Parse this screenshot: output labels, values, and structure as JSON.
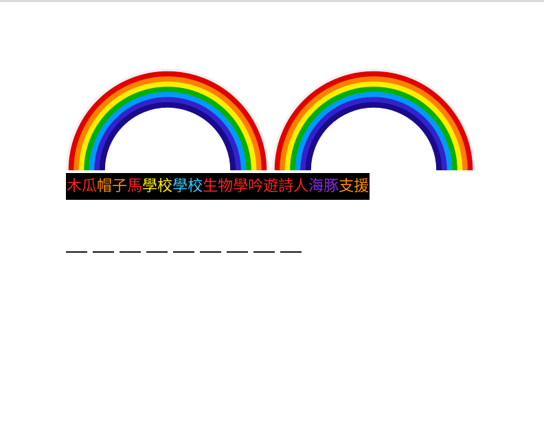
{
  "rainbow": {
    "bands": [
      "#e00000",
      "#ff7f00",
      "#ffee00",
      "#00b000",
      "#0099ff",
      "#3322cc",
      "#1a0a8c"
    ]
  },
  "banner": {
    "background": "#000000",
    "words": [
      {
        "text": "木瓜",
        "color": "#ff2020"
      },
      {
        "text": "帽子",
        "color": "#ff8c00"
      },
      {
        "text": "馬",
        "color": "#ff2020"
      },
      {
        "text": "學校",
        "color": "#ffee00"
      },
      {
        "text": "學校",
        "color": "#33ccff"
      },
      {
        "text": "生物學",
        "color": "#ff2020"
      },
      {
        "text": "吟遊詩人",
        "color": "#ff2020"
      },
      {
        "text": "海豚",
        "color": "#8a2be2"
      },
      {
        "text": "支援",
        "color": "#ff8c00"
      }
    ]
  },
  "answer_blanks": {
    "count": 9
  }
}
